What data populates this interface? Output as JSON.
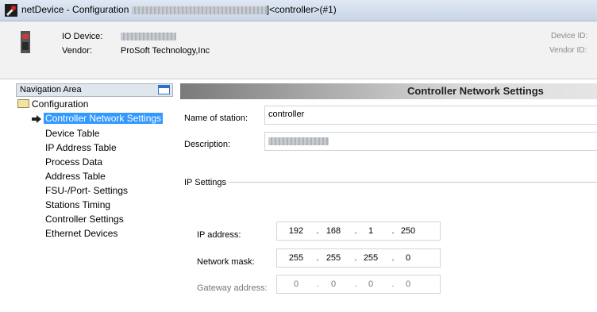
{
  "window": {
    "title_prefix": "netDevice - Configuration",
    "title_suffix": "]<controller>(#1)"
  },
  "header": {
    "io_device_label": "IO Device:",
    "vendor_label": "Vendor:",
    "vendor_value": "ProSoft Technology,Inc",
    "device_id_label": "Device ID:",
    "vendor_id_label": "Vendor ID:"
  },
  "nav": {
    "title": "Navigation Area",
    "root": "Configuration",
    "items": [
      {
        "label": "Controller Network Settings",
        "selected": true
      },
      {
        "label": "Device Table"
      },
      {
        "label": "IP Address Table"
      },
      {
        "label": "Process Data"
      },
      {
        "label": "Address Table"
      },
      {
        "label": "FSU-/Port- Settings"
      },
      {
        "label": "Stations Timing"
      },
      {
        "label": "Controller Settings"
      },
      {
        "label": "Ethernet Devices"
      }
    ]
  },
  "content": {
    "title": "Controller Network Settings",
    "station_label": "Name of station:",
    "station_value": "controller",
    "description_label": "Description:",
    "ip_settings_label": "IP Settings",
    "ip_label": "IP address:",
    "ip": [
      "192",
      "168",
      "1",
      "250"
    ],
    "mask_label": "Network mask:",
    "mask": [
      "255",
      "255",
      "255",
      "0"
    ],
    "gateway_label": "Gateway address:",
    "gateway": [
      "0",
      "0",
      "0",
      "0"
    ]
  }
}
